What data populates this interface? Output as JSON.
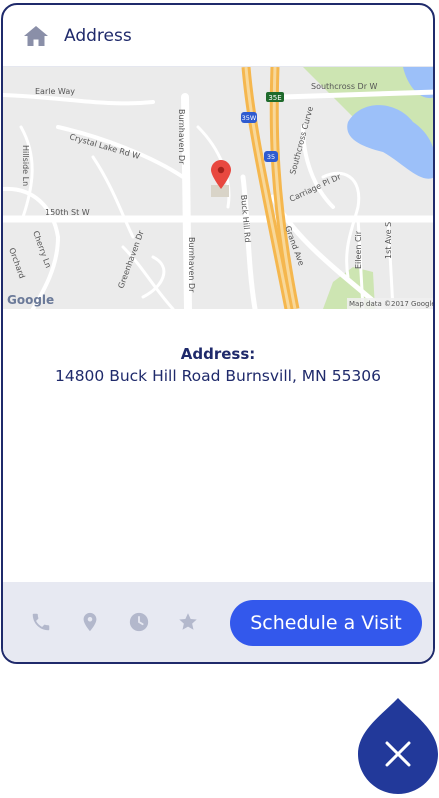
{
  "header": {
    "title": "Address",
    "icon": "home-icon"
  },
  "map": {
    "labels": {
      "earle_way": "Earle Way",
      "crystal_lake": "Crystal Lake Rd W",
      "burnhaven_top": "Burnhaven Dr",
      "burnhaven_bottom": "Burnhaven Dr",
      "hillside": "Hillside Ln",
      "street_150th": "150th St W",
      "cherry": "Cherry Ln",
      "orchard": "Orchard",
      "greenhaven": "Greenhaven Dr",
      "buck_hill": "Buck Hill Rd",
      "grand_ave": "Grand Ave",
      "southcross": "Southcross Dr W",
      "southcross_curve": "Southcross Curve",
      "carriage": "Carriage Pl Dr",
      "eileen": "Eileen Cir",
      "first_ave": "1st Ave S",
      "shield_35e": "35E",
      "shield_35": "35",
      "shield_35w": "35W",
      "google": "Google",
      "map_data": "Map data ©2017 Google"
    }
  },
  "address": {
    "label": "Address:",
    "text": "14800 Buck Hill Road Burnsvill, MN 55306"
  },
  "footer": {
    "icons": [
      "phone-icon",
      "location-pin-icon",
      "clock-icon",
      "star-icon"
    ],
    "schedule_label": "Schedule a Visit"
  },
  "colors": {
    "navy": "#1f2a6b",
    "button_blue": "#3358ec",
    "footer_bg": "#e7e9f2",
    "fab": "#22399a",
    "footer_icon": "#b3b8cc"
  }
}
